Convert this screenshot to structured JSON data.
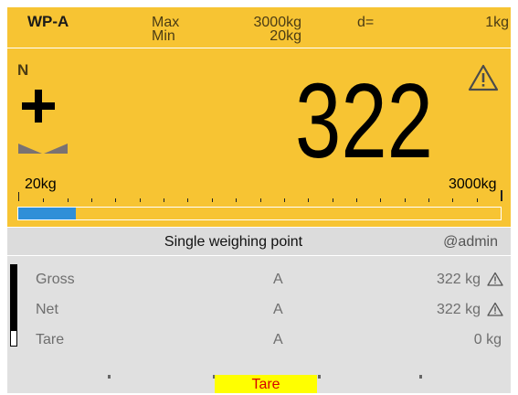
{
  "header": {
    "weighing_point": "WP-A",
    "max_label": "Max",
    "max_value": "3000kg",
    "min_label": "Min",
    "min_value": "20kg",
    "d_label": "d=",
    "d_value": "1kg"
  },
  "display": {
    "mode_flag": "N",
    "sign": "+",
    "weight": "322",
    "warning_icon": "warning-triangle-icon",
    "stability_icon": "stability-indicator-icon"
  },
  "range": {
    "min_label": "20kg",
    "max_label": "3000kg",
    "fill_fraction": 0.12,
    "fill_color": "#2f8fd8"
  },
  "panel": {
    "title": "Single weighing point",
    "user": "@admin"
  },
  "minibar_fraction": 0.18,
  "rows": [
    {
      "name": "Gross",
      "point": "A",
      "value": "322 kg",
      "warning": true
    },
    {
      "name": "Net",
      "point": "A",
      "value": "322 kg",
      "warning": true
    },
    {
      "name": "Tare",
      "point": "A",
      "value": "0 kg",
      "warning": false
    }
  ],
  "softkeys": {
    "tare_label": "Tare"
  },
  "colors": {
    "display_bg": "#f7c433",
    "panel_bg": "#e0e0e0",
    "softkey_bg": "#ffff00",
    "softkey_text": "#d80000"
  }
}
